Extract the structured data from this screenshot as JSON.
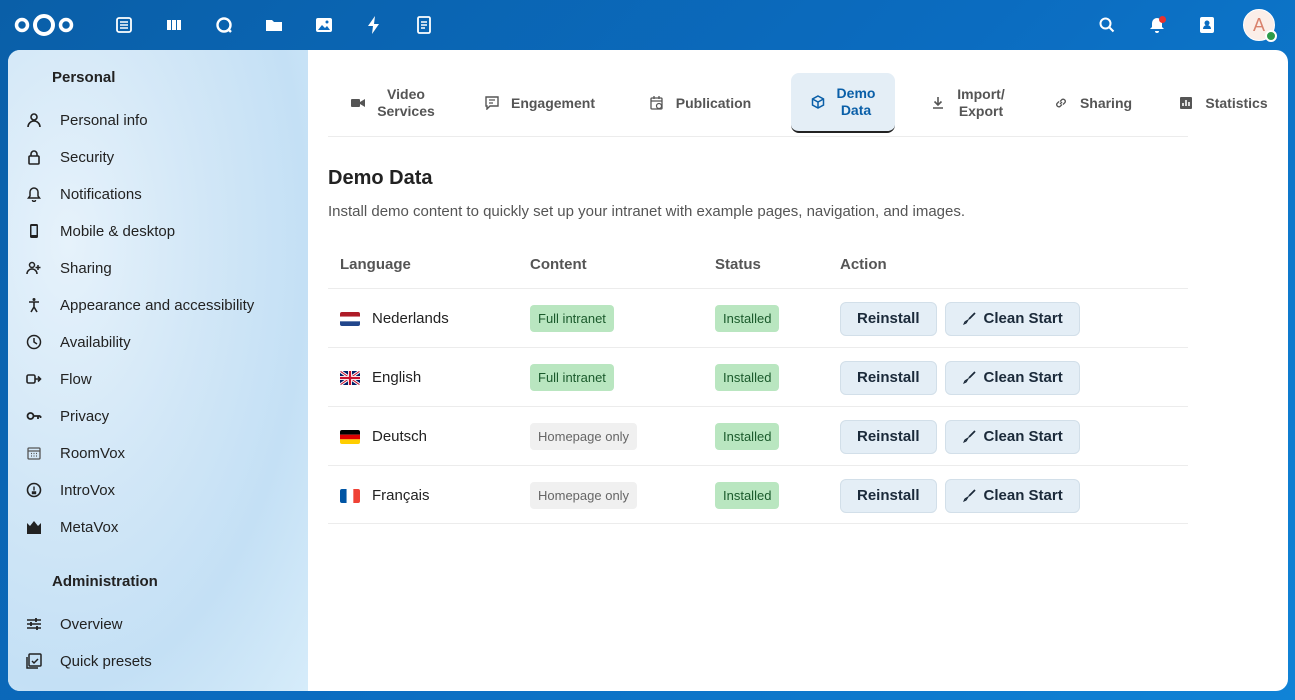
{
  "sidebar": {
    "personal_heading": "Personal",
    "personal_items": [
      {
        "label": "Personal info",
        "icon": "user-icon"
      },
      {
        "label": "Security",
        "icon": "lock-icon"
      },
      {
        "label": "Notifications",
        "icon": "bell-icon"
      },
      {
        "label": "Mobile & desktop",
        "icon": "phone-icon"
      },
      {
        "label": "Sharing",
        "icon": "share-user-icon"
      },
      {
        "label": "Appearance and accessibility",
        "icon": "accessibility-icon"
      },
      {
        "label": "Availability",
        "icon": "clock-icon"
      },
      {
        "label": "Flow",
        "icon": "flow-icon"
      },
      {
        "label": "Privacy",
        "icon": "key-icon"
      },
      {
        "label": "RoomVox",
        "icon": "calendar-grid-icon"
      },
      {
        "label": "IntroVox",
        "icon": "info-circle-icon"
      },
      {
        "label": "MetaVox",
        "icon": "metavox-icon"
      }
    ],
    "admin_heading": "Administration",
    "admin_items": [
      {
        "label": "Overview",
        "icon": "sliders-icon"
      },
      {
        "label": "Quick presets",
        "icon": "presets-icon"
      }
    ]
  },
  "tabs": [
    {
      "label": "Video\nServices",
      "icon": "video-icon"
    },
    {
      "label": "Engagement",
      "icon": "comment-icon"
    },
    {
      "label": "Publication",
      "icon": "calendar-clock-icon"
    },
    {
      "label": "Demo\nData",
      "icon": "cube-icon",
      "active": true
    },
    {
      "label": "Import/\nExport",
      "icon": "download-icon"
    },
    {
      "label": "Sharing",
      "icon": "link-icon"
    },
    {
      "label": "Statistics",
      "icon": "bar-chart-icon"
    }
  ],
  "page": {
    "title": "Demo Data",
    "subtitle": "Install demo content to quickly set up your intranet with example pages, navigation, and images."
  },
  "table": {
    "headers": [
      "Language",
      "Content",
      "Status",
      "Action"
    ],
    "rows": [
      {
        "language": "Nederlands",
        "flag": "nl",
        "content": "Full intranet",
        "content_type": "green",
        "status": "Installed"
      },
      {
        "language": "English",
        "flag": "gb",
        "content": "Full intranet",
        "content_type": "green",
        "status": "Installed"
      },
      {
        "language": "Deutsch",
        "flag": "de",
        "content": "Homepage only",
        "content_type": "grey",
        "status": "Installed"
      },
      {
        "language": "Français",
        "flag": "fr",
        "content": "Homepage only",
        "content_type": "grey",
        "status": "Installed"
      }
    ],
    "reinstall_label": "Reinstall",
    "clean_start_label": "Clean Start"
  },
  "topbar": {
    "avatar_initial": "A"
  },
  "colors": {
    "accent": "#0a5fa8",
    "badge_green": "#b9e6c0",
    "badge_grey": "#f0f0f0"
  }
}
